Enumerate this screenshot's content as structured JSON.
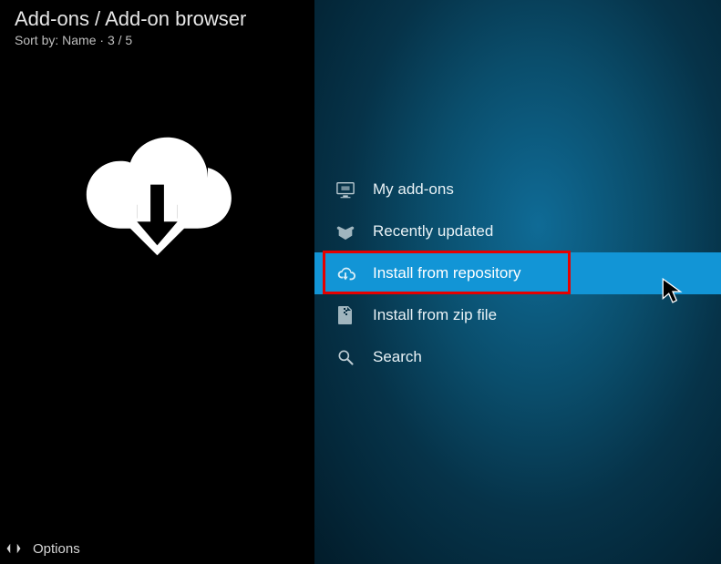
{
  "header": {
    "breadcrumb": "Add-ons / Add-on browser",
    "sort_prefix": "Sort by:",
    "sort_field": "Name",
    "position": "3 / 5"
  },
  "menu": {
    "items": [
      {
        "label": "My add-ons",
        "icon": "screen-icon",
        "selected": false
      },
      {
        "label": "Recently updated",
        "icon": "box-open-icon",
        "selected": false
      },
      {
        "label": "Install from repository",
        "icon": "cloud-download-icon",
        "selected": true
      },
      {
        "label": "Install from zip file",
        "icon": "zip-file-icon",
        "selected": false
      },
      {
        "label": "Search",
        "icon": "search-icon",
        "selected": false
      }
    ]
  },
  "footer": {
    "options_label": "Options"
  },
  "colors": {
    "selected_bg": "#1295d6",
    "highlight_border": "#e60000"
  }
}
